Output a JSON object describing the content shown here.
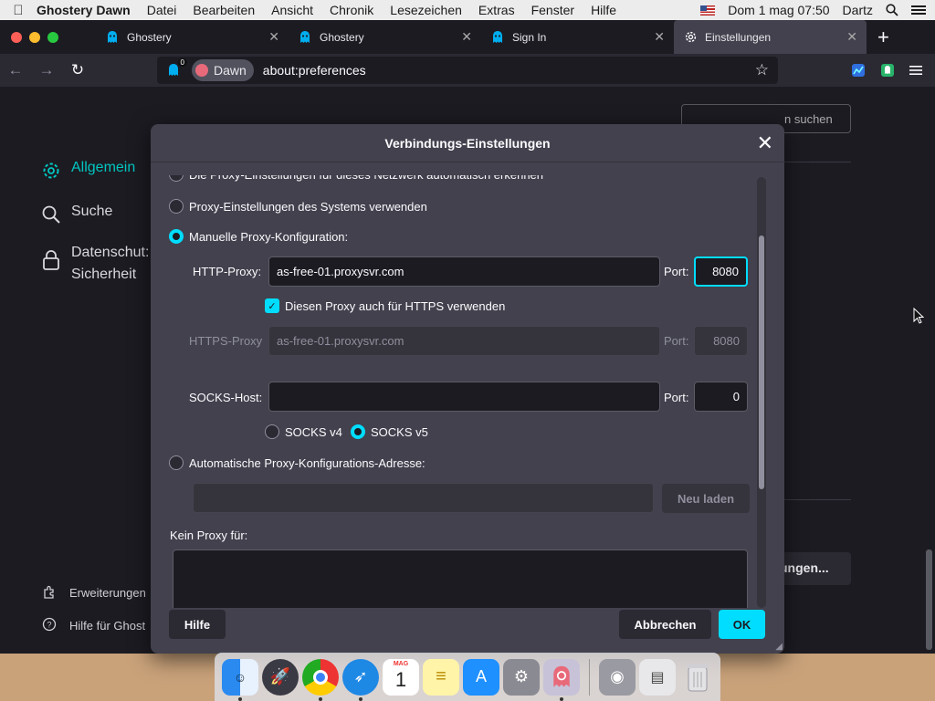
{
  "menubar": {
    "app_name": "Ghostery Dawn",
    "items": [
      "Datei",
      "Bearbeiten",
      "Ansicht",
      "Chronik",
      "Lesezeichen",
      "Extras",
      "Fenster",
      "Hilfe"
    ],
    "datetime": "Dom 1 mag  07:50",
    "user": "Dartz"
  },
  "tabs": [
    {
      "title": "Ghostery",
      "icon": "ghostery-icon"
    },
    {
      "title": "Ghostery",
      "icon": "ghostery-icon"
    },
    {
      "title": "Sign In",
      "icon": "ghostery-icon"
    },
    {
      "title": "Einstellungen",
      "icon": "gear-icon"
    }
  ],
  "navbar": {
    "tracker_count": "0",
    "chip_label": "Dawn",
    "url": "about:preferences"
  },
  "settings_page": {
    "categories": [
      "Allgemein",
      "Suche",
      "Datenschutz & Sicherheit"
    ],
    "category_privacy_line1": "Datenschut:",
    "category_privacy_line2": "Sicherheit",
    "search_placeholder": "n suchen",
    "footer_links": [
      "Erweiterungen",
      "Hilfe für Ghost"
    ],
    "button_partial": "ungen..."
  },
  "dialog": {
    "title": "Verbindungs-Einstellungen",
    "options": {
      "auto_detect": "Die Proxy-Einstellungen für dieses Netzwerk automatisch erkennen",
      "system": "Proxy-Einstellungen des Systems verwenden",
      "manual": "Manuelle Proxy-Konfiguration:",
      "pac": "Automatische Proxy-Konfigurations-Adresse:"
    },
    "http_proxy": {
      "label": "HTTP-Proxy:",
      "value": "as-free-01.proxysvr.com",
      "port_label": "Port:",
      "port": "8080"
    },
    "https_checkbox": "Diesen Proxy auch für HTTPS verwenden",
    "https_proxy": {
      "label": "HTTPS-Proxy",
      "value": "as-free-01.proxysvr.com",
      "port_label": "Port:",
      "port": "8080"
    },
    "socks": {
      "label": "SOCKS-Host:",
      "value": "",
      "port_label": "Port:",
      "port": "0",
      "v4": "SOCKS v4",
      "v5": "SOCKS v5"
    },
    "pac_url": "",
    "reload_button": "Neu laden",
    "no_proxy_label": "Kein Proxy für:",
    "no_proxy_value": "",
    "help_button": "Hilfe",
    "cancel_button": "Abbrechen",
    "ok_button": "OK"
  },
  "dock": {
    "calendar_month": "MAG",
    "calendar_day": "1"
  },
  "colors": {
    "accent": "#00ddff",
    "active_category": "#00c6c1",
    "dialog_bg": "#42414d",
    "page_bg": "#1c1b22"
  }
}
